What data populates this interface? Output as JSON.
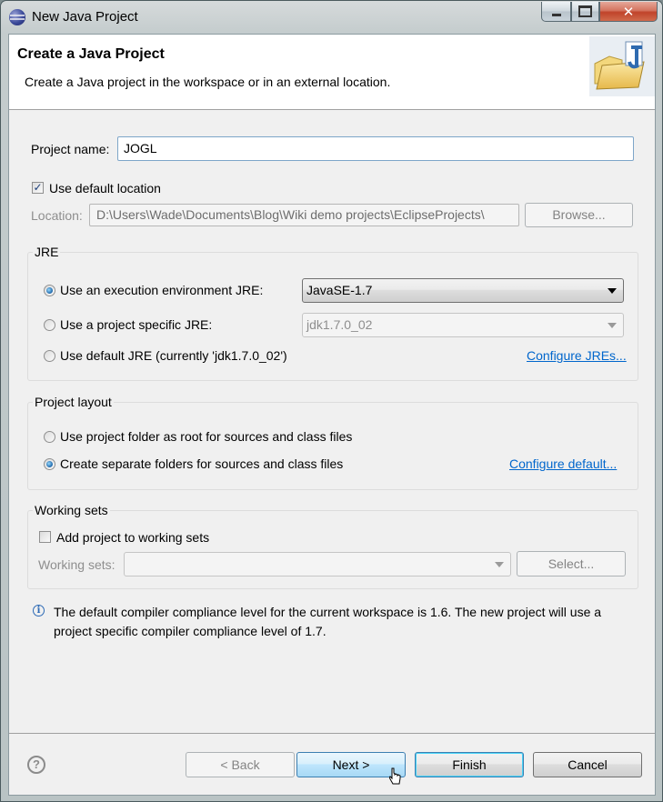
{
  "window": {
    "title": "New Java Project",
    "close_glyph": "✕"
  },
  "banner": {
    "title": "Create a Java Project",
    "description": "Create a Java project in the workspace or in an external location."
  },
  "project": {
    "name_label": "Project name:",
    "name_value": "JOGL",
    "use_default_location_label": "Use default location",
    "use_default_location_checked": true,
    "location_label": "Location:",
    "location_value": "D:\\Users\\Wade\\Documents\\Blog\\Wiki demo projects\\EclipseProjects\\",
    "browse_label": "Browse..."
  },
  "jre": {
    "group_label": "JRE",
    "options": [
      {
        "label": "Use an execution environment JRE:",
        "selected": true
      },
      {
        "label": "Use a project specific JRE:",
        "selected": false
      },
      {
        "label": "Use default JRE (currently 'jdk1.7.0_02')",
        "selected": false
      }
    ],
    "execution_env_value": "JavaSE-1.7",
    "project_jre_value": "jdk1.7.0_02",
    "configure_link": "Configure JREs..."
  },
  "layout": {
    "group_label": "Project layout",
    "options": [
      {
        "label": "Use project folder as root for sources and class files",
        "selected": false
      },
      {
        "label": "Create separate folders for sources and class files",
        "selected": true
      }
    ],
    "configure_link": "Configure default..."
  },
  "working_sets": {
    "group_label": "Working sets",
    "add_label": "Add project to working sets",
    "add_checked": false,
    "sets_label": "Working sets:",
    "sets_value": "",
    "select_label": "Select..."
  },
  "info": {
    "message": "The default compiler compliance level for the current workspace is 1.6. The new project will use a project specific compiler compliance level of 1.7."
  },
  "footer": {
    "back_label": "< Back",
    "next_label": "Next >",
    "finish_label": "Finish",
    "cancel_label": "Cancel"
  },
  "colors": {
    "link": "#0066cc",
    "selection_blue": "#2b74b5",
    "hover_button": "#bee6fd"
  }
}
